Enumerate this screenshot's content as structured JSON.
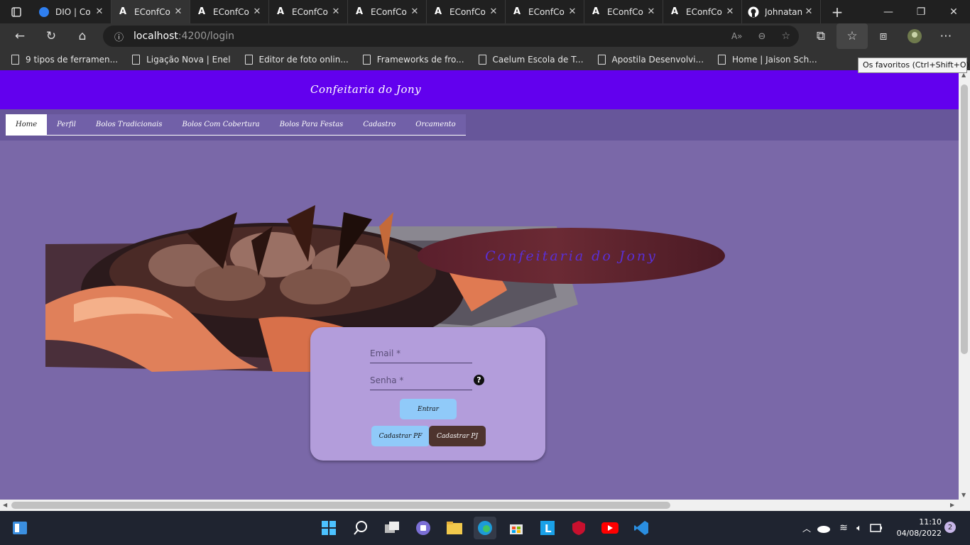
{
  "browser": {
    "tabs": [
      {
        "title": "DIO | Co",
        "icon": "dio-icon",
        "active": false
      },
      {
        "title": "EConfCo",
        "icon": "angular-icon",
        "active": true
      },
      {
        "title": "EConfCo",
        "icon": "angular-icon",
        "active": false
      },
      {
        "title": "EConfCo",
        "icon": "angular-icon",
        "active": false
      },
      {
        "title": "EConfCo",
        "icon": "angular-icon",
        "active": false
      },
      {
        "title": "EConfCo",
        "icon": "angular-icon",
        "active": false
      },
      {
        "title": "EConfCo",
        "icon": "angular-icon",
        "active": false
      },
      {
        "title": "EConfCo",
        "icon": "angular-icon",
        "active": false
      },
      {
        "title": "EConfCo",
        "icon": "angular-icon",
        "active": false
      },
      {
        "title": "Johnatan",
        "icon": "github-icon",
        "active": false
      }
    ],
    "address": {
      "host": "localhost",
      "path": ":4200/login"
    },
    "bookmarks": [
      "9 tipos de ferramen...",
      "Ligação Nova | Enel",
      "Editor de foto onlin...",
      "Frameworks de fro...",
      "Caelum Escola de T...",
      "Apostila Desenvolvi...",
      "Home | Jaison Sch..."
    ],
    "tooltip": "Os favoritos (Ctrl+Shift+O)"
  },
  "site": {
    "title": "Confeitaria do Jony",
    "nav": [
      "Home",
      "Perfil",
      "Bolos Tradicionais",
      "Bolos Com Cobertura",
      "Bolos Para Festas",
      "Cadastro",
      "Orcamento"
    ],
    "badge_text": "Confeitaria do Jony",
    "login": {
      "email_label": "Email *",
      "senha_label": "Senha *",
      "help": "?",
      "entrar": "Entrar",
      "cadastrar_pf": "Cadastrar PF",
      "cadastrar_pj": "Cadastrar PJ"
    }
  },
  "taskbar": {
    "time": "11:10",
    "date": "04/08/2022",
    "notifications": "2"
  },
  "colors": {
    "header": "#6200ee",
    "page_bg": "#7a68a8",
    "card": "#b39ddb",
    "btn_primary": "#90caf9",
    "btn_dark": "#4e342e"
  }
}
